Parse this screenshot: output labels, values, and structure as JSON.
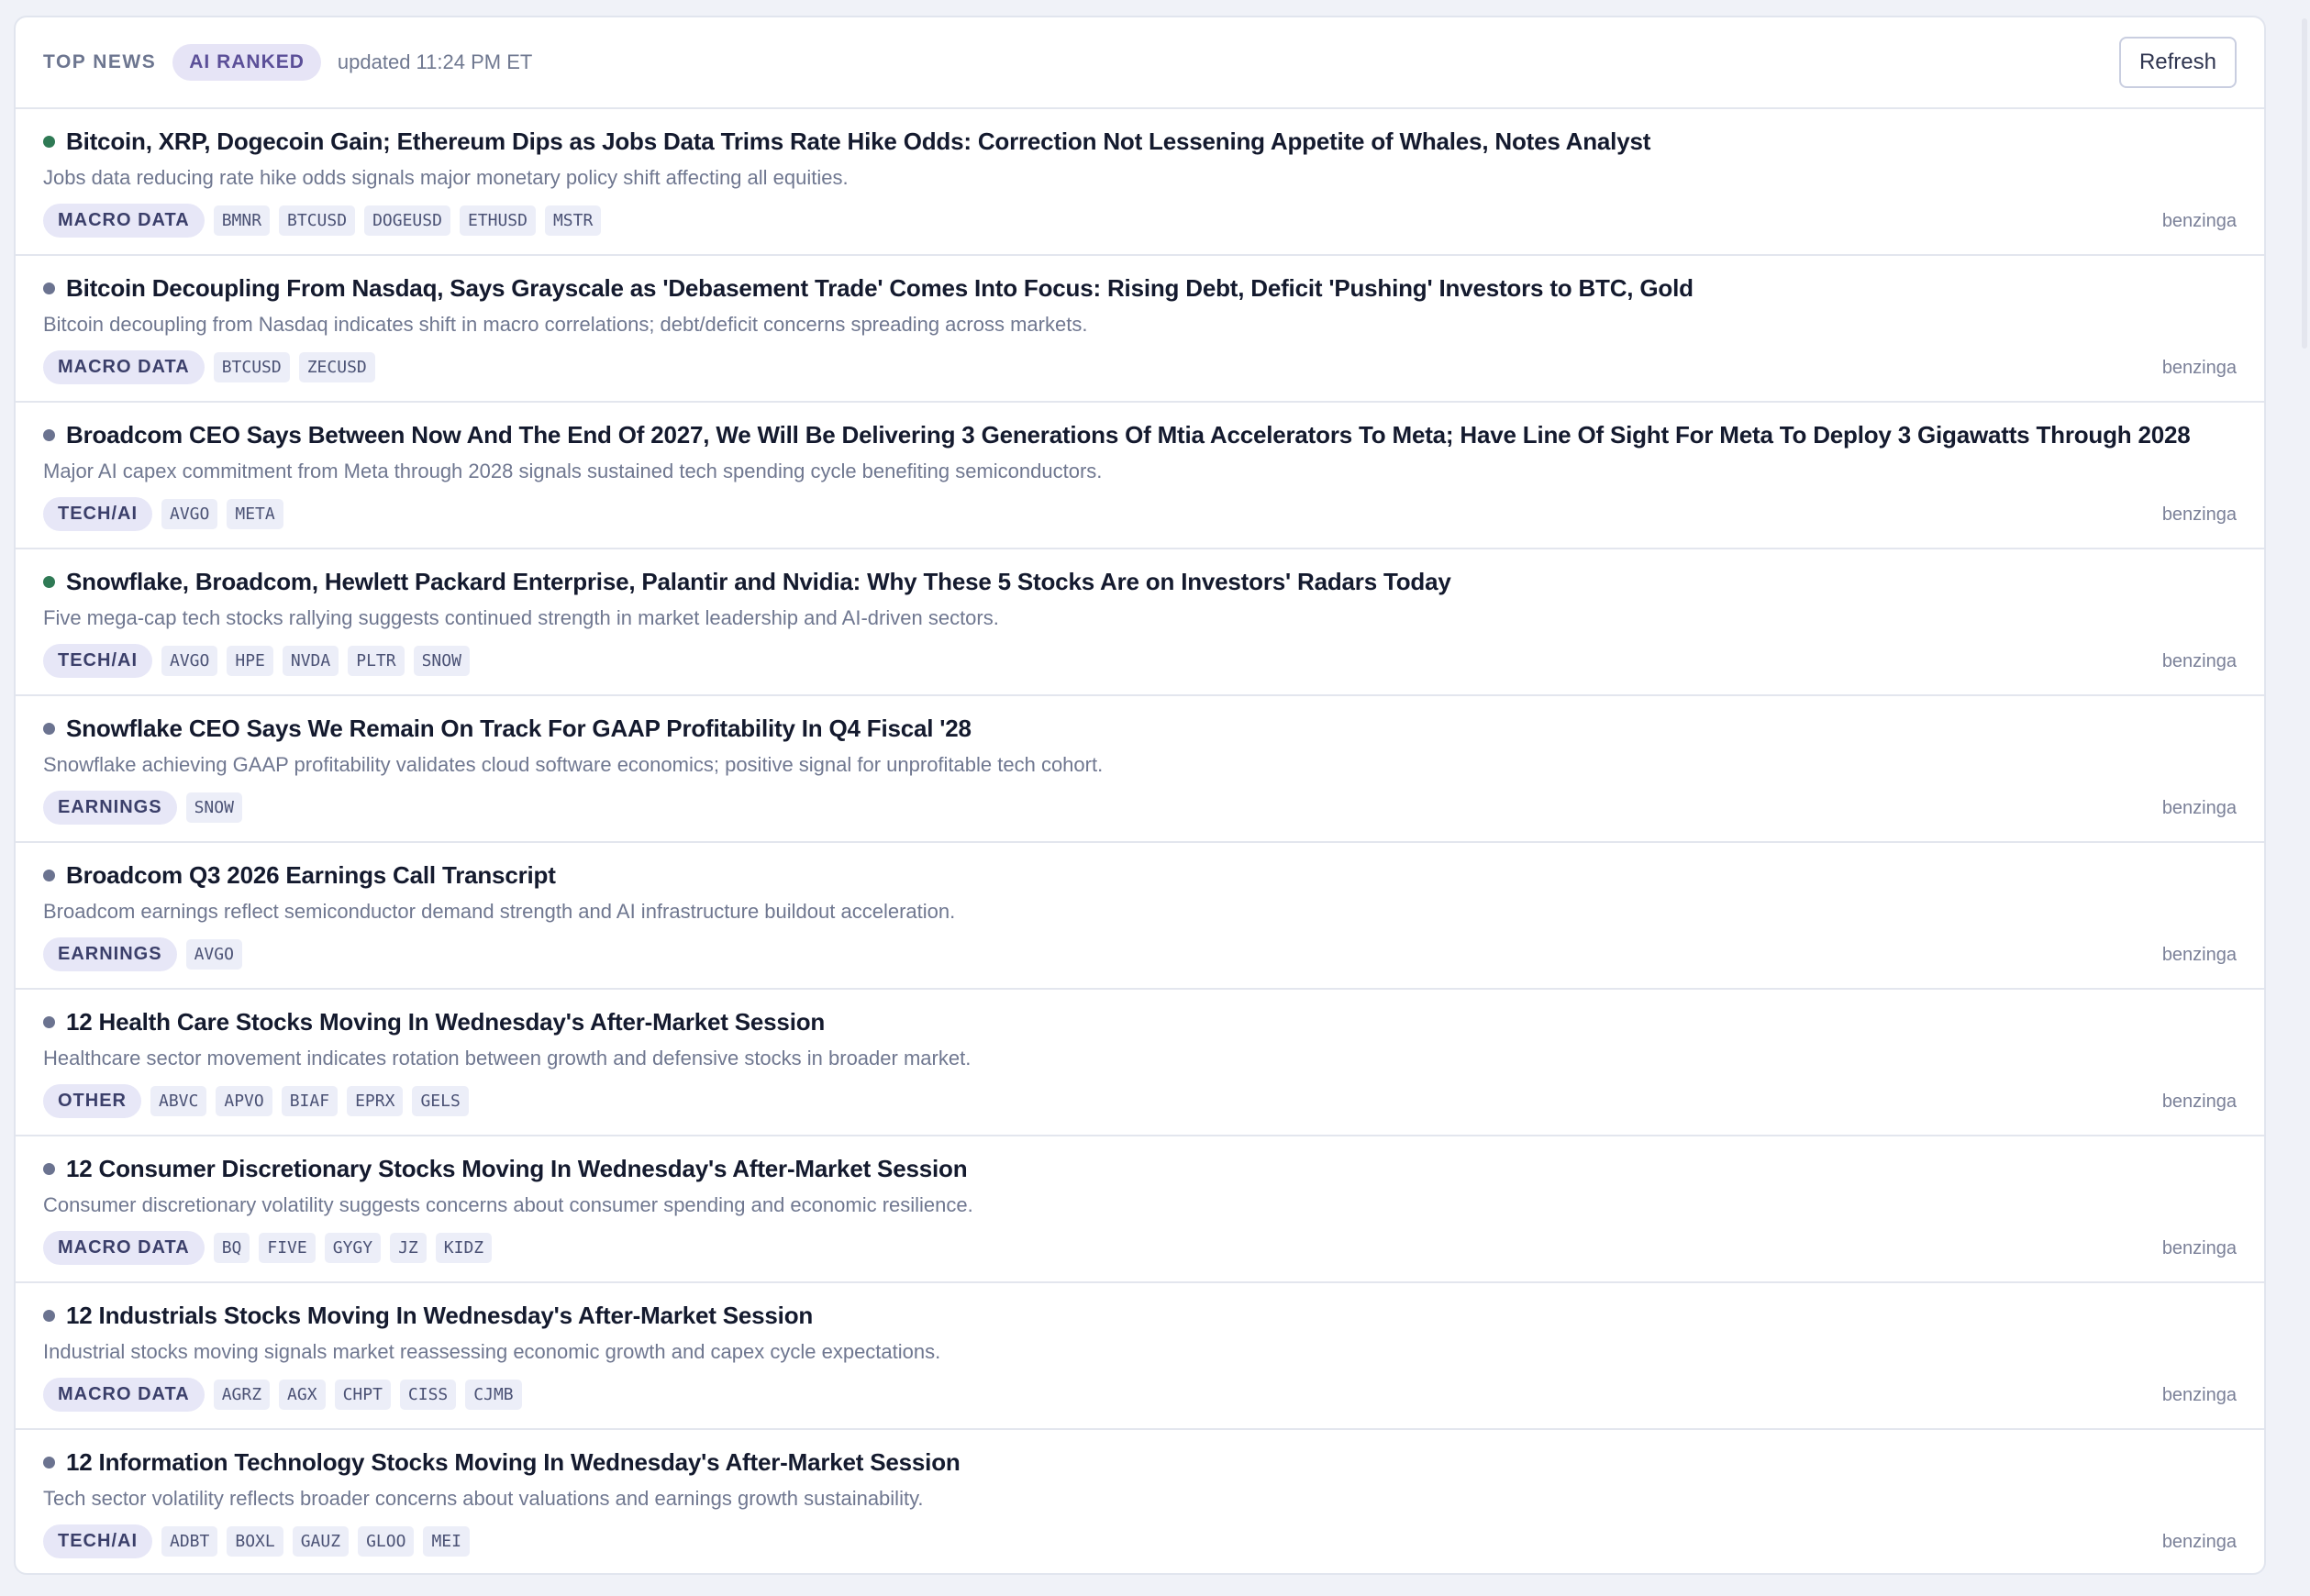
{
  "header": {
    "title": "TOP NEWS",
    "badge": "AI RANKED",
    "updated": "updated 11:24 PM ET",
    "refresh_label": "Refresh"
  },
  "colors": {
    "dot_green": "#2f7a55",
    "dot_gray": "#6b7390"
  },
  "items": [
    {
      "title": "Bitcoin, XRP, Dogecoin Gain; Ethereum Dips as Jobs Data Trims Rate Hike Odds: Correction Not Lessening Appetite of Whales, Notes Analyst",
      "summary": "Jobs data reducing rate hike odds signals major monetary policy shift affecting all equities.",
      "category": "MACRO DATA",
      "tickers": [
        "BMNR",
        "BTCUSD",
        "DOGEUSD",
        "ETHUSD",
        "MSTR"
      ],
      "source": "benzinga",
      "dot": "green"
    },
    {
      "title": "Bitcoin Decoupling From Nasdaq, Says Grayscale as 'Debasement Trade' Comes Into Focus: Rising Debt, Deficit 'Pushing' Investors to BTC, Gold",
      "summary": "Bitcoin decoupling from Nasdaq indicates shift in macro correlations; debt/deficit concerns spreading across markets.",
      "category": "MACRO DATA",
      "tickers": [
        "BTCUSD",
        "ZECUSD"
      ],
      "source": "benzinga",
      "dot": "gray"
    },
    {
      "title": "Broadcom CEO Says Between Now And The End Of 2027, We Will Be Delivering 3 Generations Of Mtia Accelerators To Meta; Have Line Of Sight For Meta To Deploy 3 Gigawatts Through 2028",
      "summary": "Major AI capex commitment from Meta through 2028 signals sustained tech spending cycle benefiting semiconductors.",
      "category": "TECH/AI",
      "tickers": [
        "AVGO",
        "META"
      ],
      "source": "benzinga",
      "dot": "gray"
    },
    {
      "title": "Snowflake, Broadcom, Hewlett Packard Enterprise, Palantir and Nvidia: Why These 5 Stocks Are on Investors' Radars Today",
      "summary": "Five mega-cap tech stocks rallying suggests continued strength in market leadership and AI-driven sectors.",
      "category": "TECH/AI",
      "tickers": [
        "AVGO",
        "HPE",
        "NVDA",
        "PLTR",
        "SNOW"
      ],
      "source": "benzinga",
      "dot": "green"
    },
    {
      "title": "Snowflake CEO Says We Remain On Track For GAAP Profitability In Q4 Fiscal '28",
      "summary": "Snowflake achieving GAAP profitability validates cloud software economics; positive signal for unprofitable tech cohort.",
      "category": "EARNINGS",
      "tickers": [
        "SNOW"
      ],
      "source": "benzinga",
      "dot": "gray"
    },
    {
      "title": "Broadcom Q3 2026 Earnings Call Transcript",
      "summary": "Broadcom earnings reflect semiconductor demand strength and AI infrastructure buildout acceleration.",
      "category": "EARNINGS",
      "tickers": [
        "AVGO"
      ],
      "source": "benzinga",
      "dot": "gray"
    },
    {
      "title": "12 Health Care Stocks Moving In Wednesday's After-Market Session",
      "summary": "Healthcare sector movement indicates rotation between growth and defensive stocks in broader market.",
      "category": "OTHER",
      "tickers": [
        "ABVC",
        "APVO",
        "BIAF",
        "EPRX",
        "GELS"
      ],
      "source": "benzinga",
      "dot": "gray"
    },
    {
      "title": "12 Consumer Discretionary Stocks Moving In Wednesday's After-Market Session",
      "summary": "Consumer discretionary volatility suggests concerns about consumer spending and economic resilience.",
      "category": "MACRO DATA",
      "tickers": [
        "BQ",
        "FIVE",
        "GYGY",
        "JZ",
        "KIDZ"
      ],
      "source": "benzinga",
      "dot": "gray"
    },
    {
      "title": "12 Industrials Stocks Moving In Wednesday's After-Market Session",
      "summary": "Industrial stocks moving signals market reassessing economic growth and capex cycle expectations.",
      "category": "MACRO DATA",
      "tickers": [
        "AGRZ",
        "AGX",
        "CHPT",
        "CISS",
        "CJMB"
      ],
      "source": "benzinga",
      "dot": "gray"
    },
    {
      "title": "12 Information Technology Stocks Moving In Wednesday's After-Market Session",
      "summary": "Tech sector volatility reflects broader concerns about valuations and earnings growth sustainability.",
      "category": "TECH/AI",
      "tickers": [
        "ADBT",
        "BOXL",
        "GAUZ",
        "GLOO",
        "MEI"
      ],
      "source": "benzinga",
      "dot": "gray"
    }
  ]
}
